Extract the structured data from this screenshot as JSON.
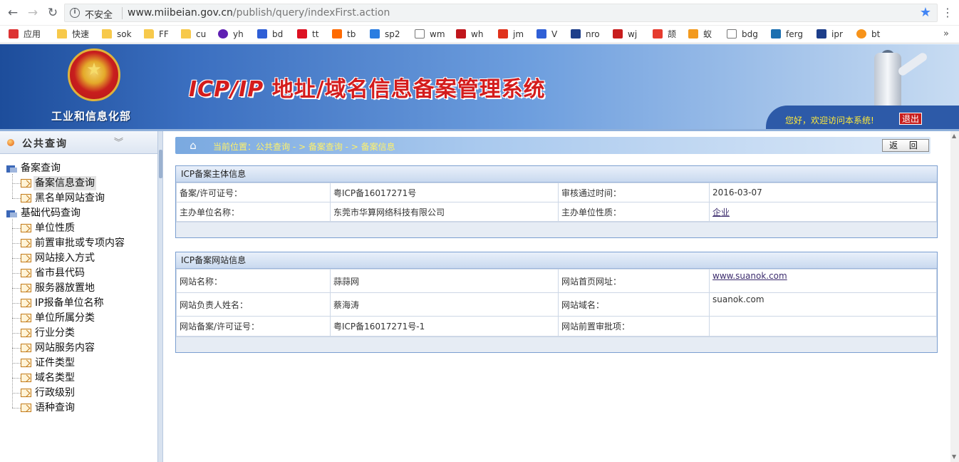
{
  "browser": {
    "insecure_label": "不安全",
    "url_host": "www.miibeian.gov.cn",
    "url_path": "/publish/query/indexFirst.action"
  },
  "bookmarks": [
    {
      "label": "应用",
      "icon": "apps-icon"
    },
    {
      "label": "快速",
      "icon": "folder-icon"
    },
    {
      "label": "sok",
      "icon": "folder-icon"
    },
    {
      "label": "FF",
      "icon": "folder-icon"
    },
    {
      "label": "cu",
      "icon": "folder-icon"
    },
    {
      "label": "yh",
      "icon": "yahoo-icon"
    },
    {
      "label": "bd",
      "icon": "baidu-paw-icon"
    },
    {
      "label": "tt",
      "icon": "red-badge-icon"
    },
    {
      "label": "tb",
      "icon": "taobao-icon"
    },
    {
      "label": "sp2",
      "icon": "blue-logo-icon"
    },
    {
      "label": "wm",
      "icon": "page-icon"
    },
    {
      "label": "wh",
      "icon": "huawei-icon"
    },
    {
      "label": "jm",
      "icon": "red-box-icon"
    },
    {
      "label": "V",
      "icon": "baidu-paw-icon"
    },
    {
      "label": "nro",
      "icon": "tv-icon"
    },
    {
      "label": "wj",
      "icon": "w-logo-icon"
    },
    {
      "label": "颉",
      "icon": "red-square-icon"
    },
    {
      "label": "蚁",
      "icon": "orange-logo-icon"
    },
    {
      "label": "bdg",
      "icon": "page-icon"
    },
    {
      "label": "ferg",
      "icon": "teal-logo-icon"
    },
    {
      "label": "ipr",
      "icon": "tv-icon"
    },
    {
      "label": "bt",
      "icon": "bitcoin-icon"
    }
  ],
  "header": {
    "ministry": "工业和信息化部",
    "title_latin": "ICP/IP",
    "title_cn": " 地址/域名信息备案管理系统",
    "welcome": "您好，欢迎访问本系统!",
    "logout": "退出"
  },
  "sidebar": {
    "title": "公共查询",
    "groups": [
      {
        "label": "备案查询",
        "items": [
          "备案信息查询",
          "黑名单网站查询"
        ]
      },
      {
        "label": "基础代码查询",
        "items": [
          "单位性质",
          "前置审批或专项内容",
          "网站接入方式",
          "省市县代码",
          "服务器放置地",
          "IP报备单位名称",
          "单位所属分类",
          "行业分类",
          "网站服务内容",
          "证件类型",
          "域名类型",
          "行政级别",
          "语种查询"
        ]
      }
    ]
  },
  "breadcrumb": "当前位置：公共查询 - > 备案查询 - > 备案信息",
  "back_button": "返 回",
  "subject_panel": {
    "title": "ICP备案主体信息",
    "rows": [
      {
        "l1": "备案/许可证号：",
        "v1": "粤ICP备16017271号",
        "l2": "审核通过时间：",
        "v2": "2016-03-07"
      },
      {
        "l1": "主办单位名称：",
        "v1": "东莞市华算网络科技有限公司",
        "l2": "主办单位性质：",
        "v2": "企业"
      }
    ]
  },
  "website_panel": {
    "title": "ICP备案网站信息",
    "rows": [
      {
        "l1": "网站名称：",
        "v1": "蒜蒜网",
        "l2": "网站首页网址：",
        "v2": "www.suanok.com"
      },
      {
        "l1": "网站负责人姓名：",
        "v1": "蔡海涛",
        "l2": "网站域名：",
        "v2": "suanok.com"
      },
      {
        "l1": "网站备案/许可证号：",
        "v1": "粤ICP备16017271号-1",
        "l2": "网站前置审批项：",
        "v2": ""
      }
    ]
  }
}
